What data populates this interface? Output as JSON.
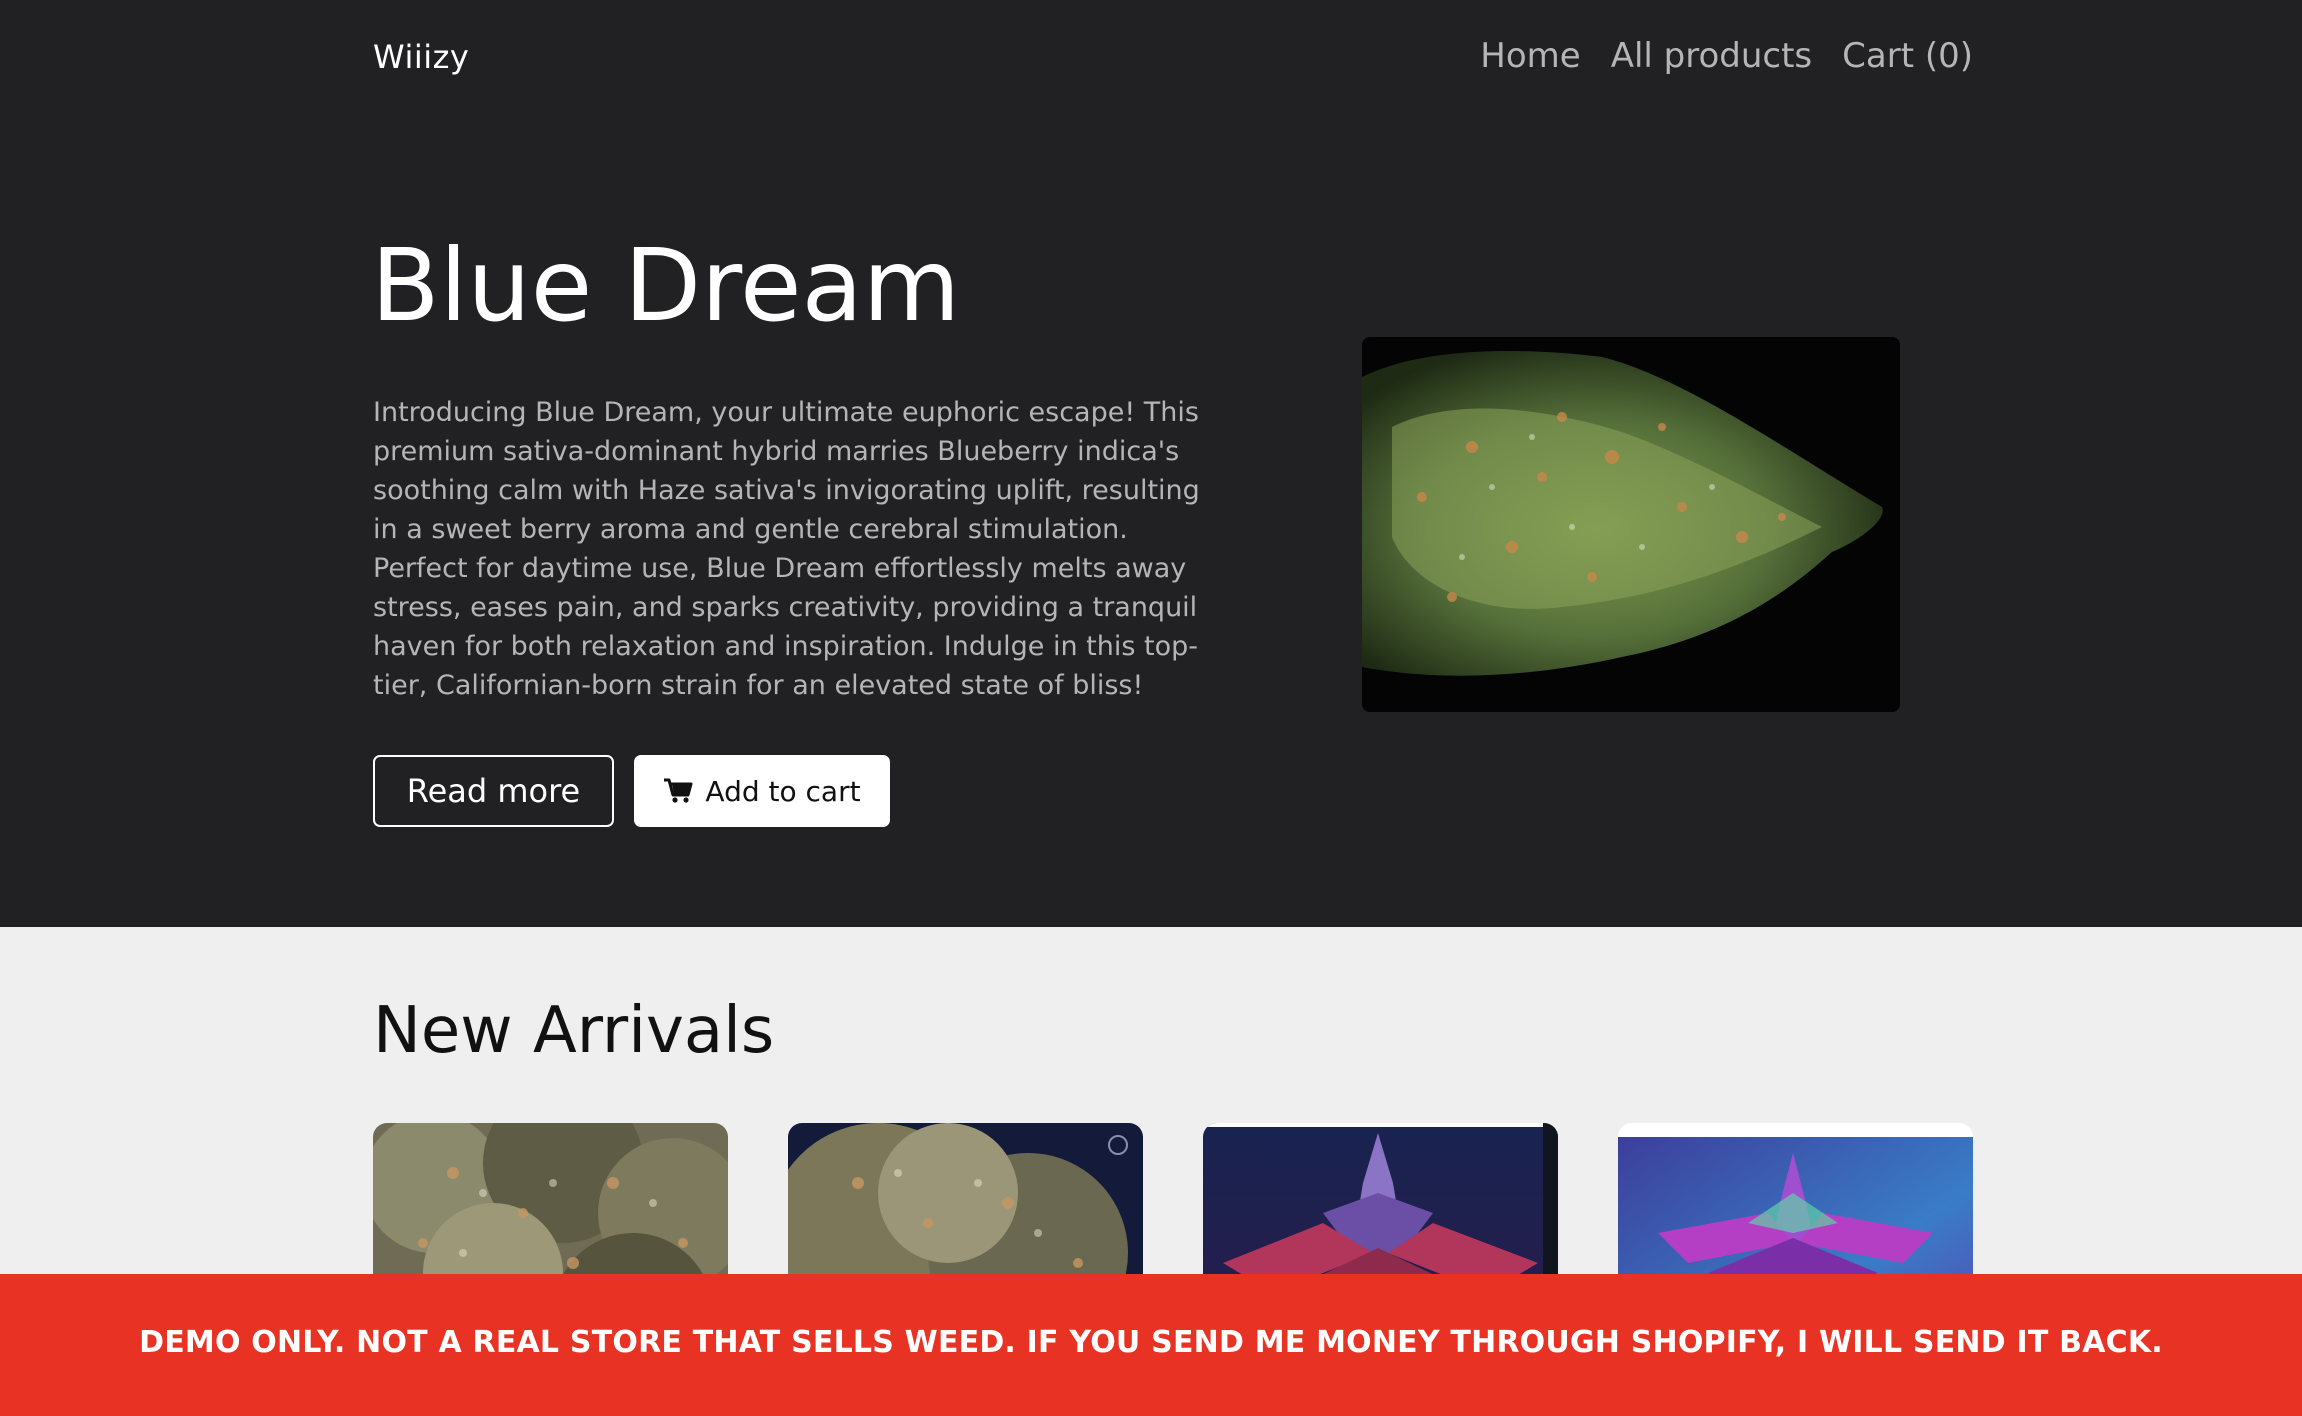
{
  "header": {
    "brand": "Wiiizy",
    "nav": [
      {
        "label": "Home"
      },
      {
        "label": "All products"
      },
      {
        "label": "Cart (0)"
      }
    ]
  },
  "hero": {
    "title": "Blue Dream",
    "description": "Introducing Blue Dream, your ultimate euphoric escape! This premium sativa-dominant hybrid marries Blueberry indica's soothing calm with Haze sativa's invigorating uplift, resulting in a sweet berry aroma and gentle cerebral stimulation. Perfect for daytime use, Blue Dream effortlessly melts away stress, eases pain, and sparks creativity, providing a tranquil haven for both relaxation and inspiration. Indulge in this top-tier, Californian-born strain for an elevated state of bliss!",
    "read_more_label": "Read more",
    "add_to_cart_label": "Add to cart",
    "image_icon": "cannabis-bud-photo"
  },
  "arrivals": {
    "title": "New Arrivals",
    "products": [
      {
        "image_icon": "cannabis-buds-photo"
      },
      {
        "image_icon": "cannabis-buds-photo"
      },
      {
        "image_icon": "cannabis-plant-photo"
      },
      {
        "image_icon": "cannabis-plant-photo"
      }
    ]
  },
  "banner": {
    "text": "DEMO ONLY. NOT A REAL STORE THAT SELLS WEED. IF YOU SEND ME MONEY THROUGH SHOPIFY, I WILL SEND IT BACK."
  },
  "colors": {
    "hero_background": "#212123",
    "section_background": "#efeff0",
    "banner_red": "#e73224",
    "muted_text": "#b5b5b8"
  }
}
